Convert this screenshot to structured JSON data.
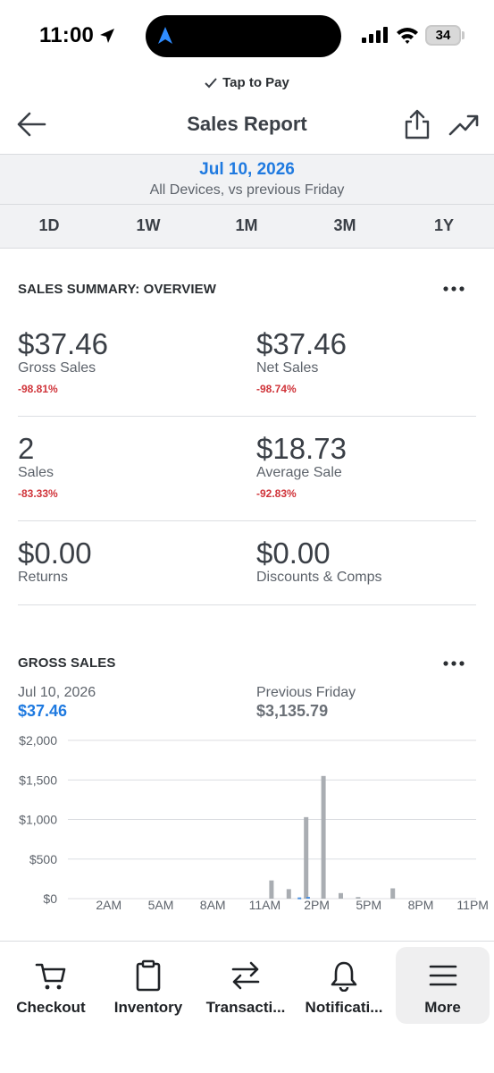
{
  "status_bar": {
    "time": "11:00",
    "battery": "34"
  },
  "tap_to_pay": "Tap to Pay",
  "header": {
    "title": "Sales Report"
  },
  "date_band": {
    "date": "Jul 10, 2026",
    "subtitle": "All Devices, vs previous Friday",
    "ranges": [
      "1D",
      "1W",
      "1M",
      "3M",
      "1Y"
    ]
  },
  "summary": {
    "title": "SALES SUMMARY: OVERVIEW",
    "metrics": [
      {
        "value": "$37.46",
        "label": "Gross Sales",
        "change": "-98.81%"
      },
      {
        "value": "$37.46",
        "label": "Net Sales",
        "change": "-98.74%"
      },
      {
        "value": "2",
        "label": "Sales",
        "change": "-83.33%"
      },
      {
        "value": "$18.73",
        "label": "Average Sale",
        "change": "-92.83%"
      },
      {
        "value": "$0.00",
        "label": "Returns",
        "change": ""
      },
      {
        "value": "$0.00",
        "label": "Discounts & Comps",
        "change": ""
      }
    ]
  },
  "gross_sales": {
    "title": "GROSS SALES",
    "current": {
      "date": "Jul 10, 2026",
      "value": "$37.46"
    },
    "previous": {
      "date": "Previous Friday",
      "value": "$3,135.79"
    }
  },
  "chart_data": {
    "type": "bar",
    "ylim": [
      0,
      2000
    ],
    "y_ticks": [
      "$2,000",
      "$1,500",
      "$1,000",
      "$500",
      "$0"
    ],
    "y_tick_values": [
      2000,
      1500,
      1000,
      500,
      0
    ],
    "x_ticks": [
      "2AM",
      "5AM",
      "8AM",
      "11AM",
      "2PM",
      "5PM",
      "8PM",
      "11PM"
    ],
    "x_tick_hours": [
      2,
      5,
      8,
      11,
      14,
      17,
      20,
      23
    ],
    "colors": {
      "current": "#4a8fe0",
      "previous": "#a9adb2",
      "grid": "#dcdee2"
    },
    "series": [
      {
        "name": "Jul 10, 2026",
        "points": [
          {
            "hour": 13,
            "value": 15
          },
          {
            "hour": 13.5,
            "value": 22
          }
        ]
      },
      {
        "name": "Previous Friday",
        "points": [
          {
            "hour": 11,
            "value": 230
          },
          {
            "hour": 12,
            "value": 120
          },
          {
            "hour": 13,
            "value": 1030
          },
          {
            "hour": 14,
            "value": 1550
          },
          {
            "hour": 15,
            "value": 70
          },
          {
            "hour": 16,
            "value": 20
          },
          {
            "hour": 18,
            "value": 130
          }
        ]
      }
    ]
  },
  "bottom_nav": {
    "items": [
      {
        "label": "Checkout",
        "icon": "cart-icon"
      },
      {
        "label": "Inventory",
        "icon": "clipboard-icon"
      },
      {
        "label": "Transacti...",
        "icon": "transactions-icon"
      },
      {
        "label": "Notificati...",
        "icon": "bell-icon"
      },
      {
        "label": "More",
        "icon": "menu-icon"
      }
    ]
  }
}
